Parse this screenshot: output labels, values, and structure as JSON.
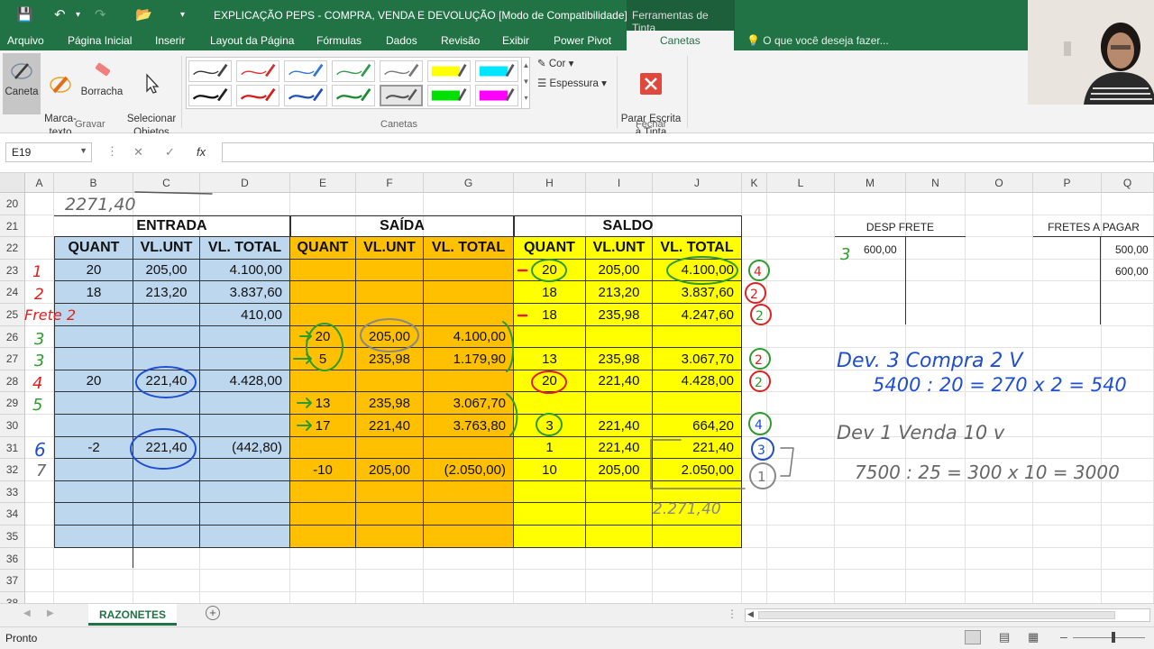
{
  "window": {
    "title": "EXPLICAÇÃO PEPS - COMPRA, VENDA E  DEVOLUÇÃO  [Modo de Compatibilidade]...",
    "context_tab": "Ferramentas de Tinta"
  },
  "menu": {
    "tabs": [
      "Arquivo",
      "Página Inicial",
      "Inserir",
      "Layout da Página",
      "Fórmulas",
      "Dados",
      "Revisão",
      "Exibir",
      "Power Pivot",
      "Canetas"
    ],
    "active_tab": "Canetas",
    "tell_me": "O que você deseja fazer..."
  },
  "ribbon": {
    "write_group": {
      "label": "Gravar",
      "buttons": [
        {
          "label": "Caneta",
          "icon": "pen-icon"
        },
        {
          "label": "Marca-\ntexto",
          "icon": "highlighter-icon"
        },
        {
          "label": "Borracha",
          "icon": "eraser-icon"
        },
        {
          "label": "Selecionar\nObjetos",
          "icon": "select-cursor-icon"
        }
      ]
    },
    "pens_group": {
      "label": "Canetas",
      "pens": [
        {
          "color": "#333333",
          "type": "pen"
        },
        {
          "color": "#e03030",
          "type": "pen"
        },
        {
          "color": "#2f75d6",
          "type": "pen"
        },
        {
          "color": "#2e9b4a",
          "type": "pen"
        },
        {
          "color": "#777777",
          "type": "pen"
        },
        {
          "color": "#ffff00",
          "type": "highlighter"
        },
        {
          "color": "#00e5ff",
          "type": "highlighter"
        },
        {
          "color": "#111111",
          "type": "pen"
        },
        {
          "color": "#d81b1b",
          "type": "pen"
        },
        {
          "color": "#1f4fb8",
          "type": "pen"
        },
        {
          "color": "#1b8a2e",
          "type": "pen"
        },
        {
          "color": "#555555",
          "type": "pen",
          "selected": true
        },
        {
          "color": "#00e000",
          "type": "highlighter"
        },
        {
          "color": "#ff00ff",
          "type": "highlighter"
        }
      ],
      "color_label": "Cor",
      "thickness_label": "Espessura"
    },
    "close_group": {
      "label": "Fechar",
      "stop_label": "Parar Escrita\nà Tinta"
    }
  },
  "formula_bar": {
    "name_box": "E19",
    "formula": ""
  },
  "columns": [
    "A",
    "B",
    "C",
    "D",
    "E",
    "F",
    "G",
    "H",
    "I",
    "J",
    "K",
    "L",
    "M",
    "N",
    "O",
    "P",
    "Q"
  ],
  "rows": [
    "20",
    "21",
    "22",
    "23",
    "24",
    "25",
    "26",
    "27",
    "28",
    "29",
    "30",
    "31",
    "32",
    "33",
    "34",
    "35",
    "36",
    "37",
    "38"
  ],
  "sheet": {
    "sections": {
      "entrada": "ENTRADA",
      "saida": "SAÍDA",
      "saldo": "SALDO"
    },
    "headers": [
      "QUANT",
      "VL.UNT",
      "VL. TOTAL",
      "QUANT",
      "VL.UNT",
      "VL. TOTAL",
      "QUANT",
      "VL.UNT",
      "VL. TOTAL"
    ],
    "table": [
      [
        "20",
        "205,00",
        "4.100,00",
        "",
        "",
        "",
        "20",
        "205,00",
        "4.100,00"
      ],
      [
        "18",
        "213,20",
        "3.837,60",
        "",
        "",
        "",
        "18",
        "213,20",
        "3.837,60"
      ],
      [
        "",
        "",
        "410,00",
        "",
        "",
        "",
        "18",
        "235,98",
        "4.247,60"
      ],
      [
        "",
        "",
        "",
        "20",
        "205,00",
        "4.100,00",
        "",
        "",
        ""
      ],
      [
        "",
        "",
        "",
        "5",
        "235,98",
        "1.179,90",
        "13",
        "235,98",
        "3.067,70"
      ],
      [
        "20",
        "221,40",
        "4.428,00",
        "",
        "",
        "",
        "20",
        "221,40",
        "4.428,00"
      ],
      [
        "",
        "",
        "",
        "13",
        "235,98",
        "3.067,70",
        "",
        "",
        ""
      ],
      [
        "",
        "",
        "",
        "17",
        "221,40",
        "3.763,80",
        "3",
        "221,40",
        "664,20"
      ],
      [
        "-2",
        "221,40",
        "(442,80)",
        "",
        "",
        "",
        "1",
        "221,40",
        "221,40"
      ],
      [
        "",
        "",
        "",
        "-10",
        "205,00",
        "(2.050,00)",
        "10",
        "205,00",
        "2.050,00"
      ],
      [
        "",
        "",
        "",
        "",
        "",
        "",
        "",
        "",
        ""
      ],
      [
        "",
        "",
        "",
        "",
        "",
        "",
        "",
        "",
        ""
      ],
      [
        "",
        "",
        "",
        "",
        "",
        "",
        "",
        "",
        ""
      ]
    ],
    "desp_frete": {
      "title": "DESP FRETE",
      "value": "600,00"
    },
    "fretes_a_pagar": {
      "title": "FRETES A PAGAR",
      "values": [
        "500,00",
        "600,00"
      ]
    },
    "handwriting": {
      "top_note": "2271,40",
      "frete_note": "Frete 2",
      "row_numbers": [
        "1",
        "2",
        "3",
        "3",
        "4",
        "5",
        "6",
        "7"
      ],
      "desp_note": "3",
      "k_marks": [
        "4",
        "2",
        "2",
        "2",
        "2",
        "4",
        "3",
        "1"
      ],
      "note1_line1": "Dev. 3 Compra 2 V",
      "note1_line2": "5400 : 20 = 270 x 2 = 540",
      "note2_line1": "Dev 1 Venda 10 v",
      "note2_line2": "7500 : 25 = 300 x 10 = 3000",
      "sum_note": "2.271,40"
    }
  },
  "sheet_tab": "RAZONETES",
  "status": "Pronto"
}
